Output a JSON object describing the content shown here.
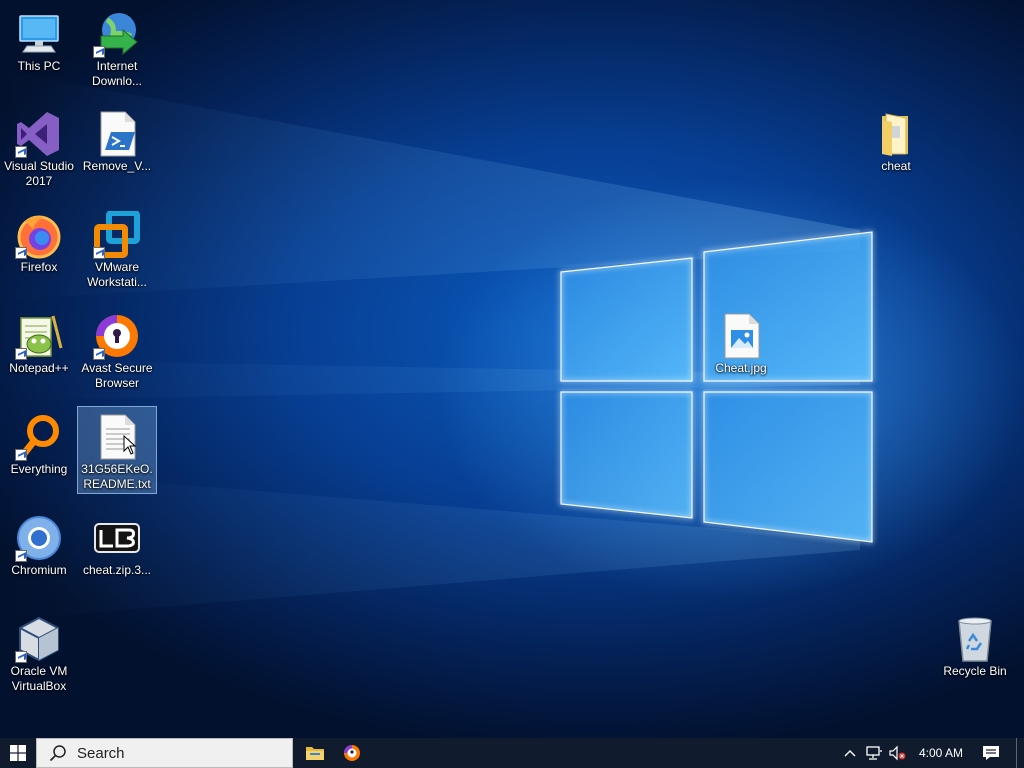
{
  "desktop": {
    "icons": [
      {
        "label": "This PC",
        "icon": "this-pc-icon"
      },
      {
        "label": "Internet Downlo...",
        "icon": "internet-download-manager-icon"
      },
      {
        "label": "Visual Studio 2017",
        "icon": "visual-studio-icon"
      },
      {
        "label": "Remove_V...",
        "icon": "powershell-script-icon"
      },
      {
        "label": "Firefox",
        "icon": "firefox-icon"
      },
      {
        "label": "VMware Workstati...",
        "icon": "vmware-icon"
      },
      {
        "label": "Notepad++",
        "icon": "notepad-plus-plus-icon"
      },
      {
        "label": "Avast Secure Browser",
        "icon": "avast-browser-icon"
      },
      {
        "label": "Everything",
        "icon": "everything-search-icon"
      },
      {
        "label": "31G56EKeO.README.txt",
        "icon": "text-file-icon"
      },
      {
        "label": "Chromium",
        "icon": "chromium-icon"
      },
      {
        "label": "cheat.zip.3...",
        "icon": "lb-archive-icon"
      },
      {
        "label": "Oracle VM VirtualBox",
        "icon": "virtualbox-icon"
      },
      {
        "label": "cheat",
        "icon": "folder-icon"
      },
      {
        "label": "Cheat.jpg",
        "icon": "image-file-icon"
      },
      {
        "label": "Recycle Bin",
        "icon": "recycle-bin-icon"
      }
    ]
  },
  "taskbar": {
    "search_placeholder": "Search",
    "clock": "4:00 AM",
    "pinned": [
      {
        "name": "file-explorer",
        "icon": "folder-icon"
      },
      {
        "name": "avast-secure-browser",
        "icon": "avast-browser-icon"
      }
    ]
  },
  "colors": {
    "taskbar_bg": "#101c2e",
    "wallpaper_blue": "#0a5cc0",
    "selection": "#82b4e6"
  }
}
